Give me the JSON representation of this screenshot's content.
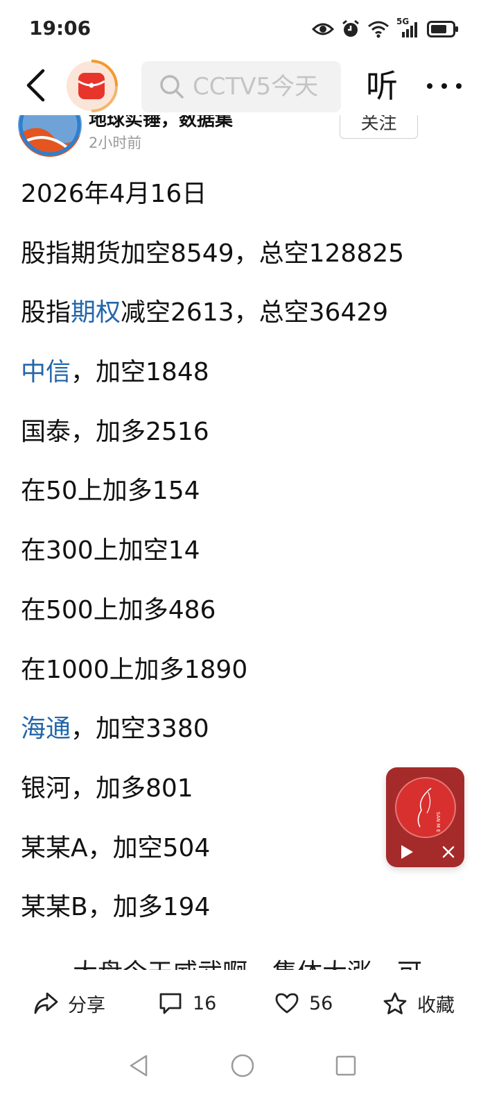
{
  "status_bar": {
    "time": "19:06",
    "network": "5G",
    "icons": [
      "eye-icon",
      "alarm-icon",
      "wifi-icon",
      "signal-icon",
      "battery-icon"
    ]
  },
  "nav": {
    "search_placeholder": "CCTV5今天",
    "listen_label": "听",
    "icons": [
      "back-arrow-icon",
      "app-logo",
      "search-icon",
      "more-icon"
    ]
  },
  "author": {
    "name": "地球实锤，数据集",
    "time": "2小时前",
    "follow_label": "关注"
  },
  "article": {
    "date": "2026年4月16日",
    "lines": {
      "l1": "股指期货加空8549，总空128825",
      "l2_a": "股指",
      "l2_link": "期权",
      "l2_b": "减空2613，总空36429",
      "l3_link": "中信",
      "l3_b": "，加空1848",
      "l4": "国泰，加多2516",
      "l5": "在50上加多154",
      "l6": "在300上加空14",
      "l7": "在500上加多486",
      "l8": "在1000上加多1890",
      "l9_link": "海通",
      "l9_b": "，加空3380",
      "l10": "银河，加多801",
      "l11": "某某A，加空504",
      "l12": "某某B，加多194",
      "l13_partial": "大盘今天威武啊，集体大涨，可"
    },
    "colors": {
      "text": "#111111",
      "link": "#2266aa"
    }
  },
  "floating_player": {
    "disc_text": "SAN M E",
    "icons": [
      "play-icon",
      "close-icon"
    ],
    "background": "#a52a2a"
  },
  "action_bar": {
    "share_label": "分享",
    "comment_count": "16",
    "like_count": "56",
    "favorite_label": "收藏"
  },
  "android_nav": {
    "icons": [
      "back-triangle-icon",
      "home-circle-icon",
      "recents-square-icon"
    ]
  }
}
